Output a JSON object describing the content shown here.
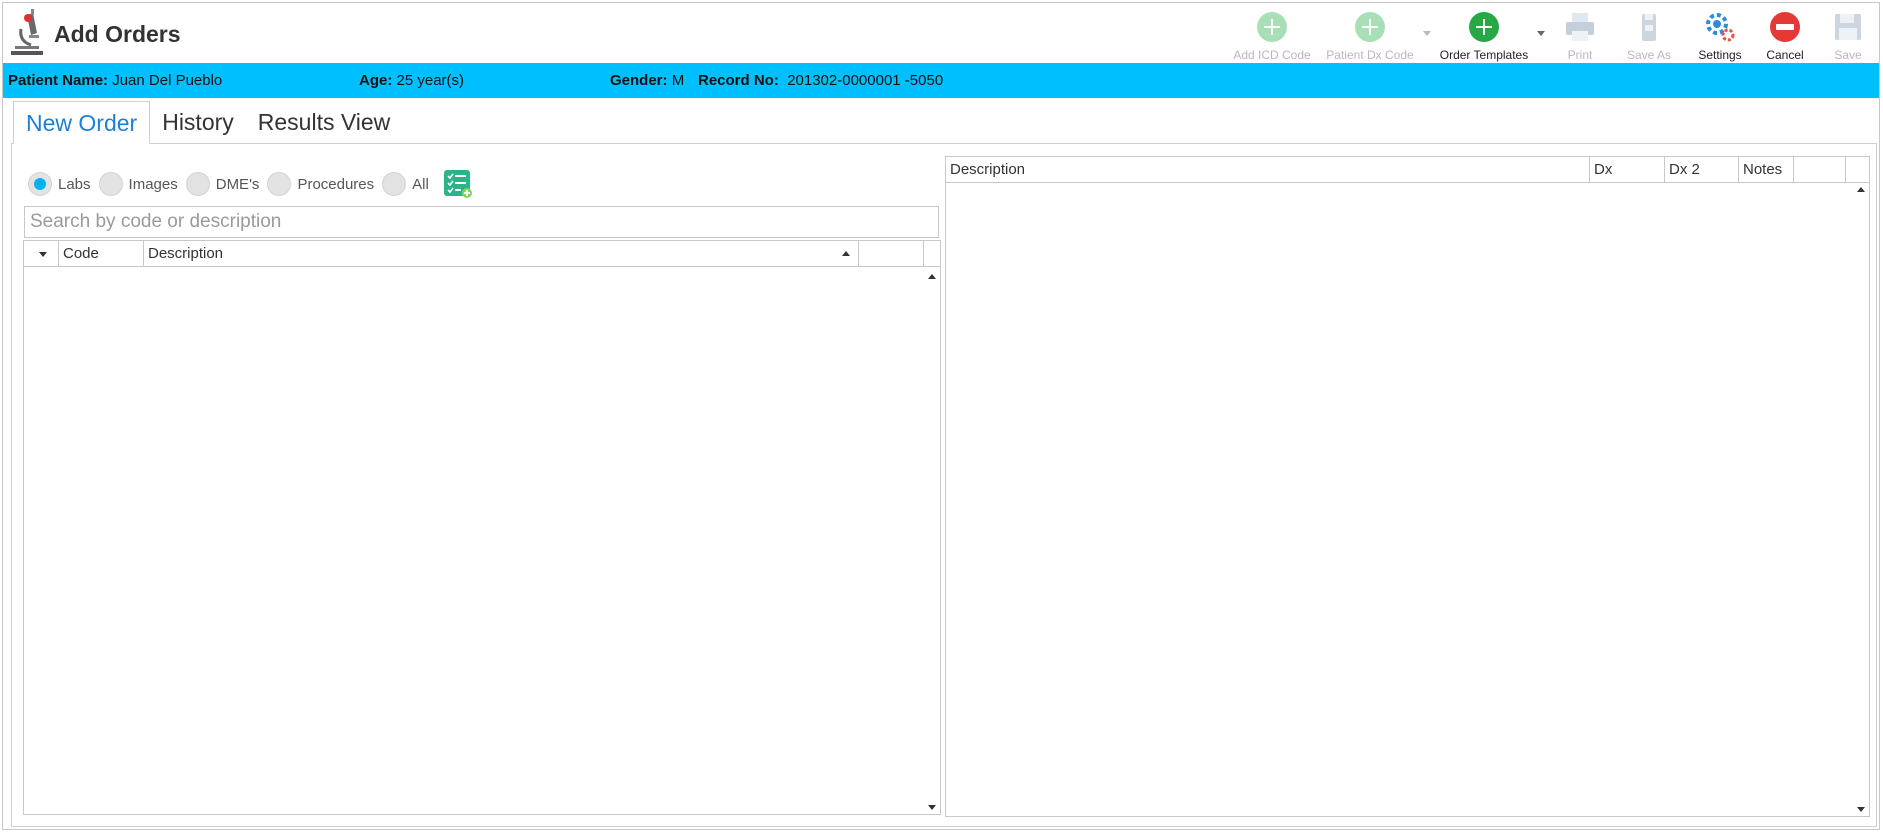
{
  "app": {
    "title": "Add Orders",
    "icon": "microscope-icon"
  },
  "toolbar": {
    "add_icd": {
      "label": "Add ICD Code",
      "icon": "plus-circle-icon",
      "enabled": false
    },
    "patient_dx": {
      "label": "Patient Dx Code",
      "icon": "plus-circle-icon",
      "enabled": false
    },
    "order_templates": {
      "label": "Order Templates",
      "icon": "plus-circle-icon",
      "enabled": true
    },
    "print": {
      "label": "Print",
      "icon": "printer-icon",
      "enabled": false
    },
    "save_as": {
      "label": "Save As",
      "icon": "save-as-icon",
      "enabled": false
    },
    "settings": {
      "label": "Settings",
      "icon": "gears-icon",
      "enabled": true
    },
    "cancel": {
      "label": "Cancel",
      "icon": "no-entry-icon",
      "enabled": true
    },
    "save": {
      "label": "Save",
      "icon": "floppy-disk-icon",
      "enabled": false
    }
  },
  "patient": {
    "name_label": "Patient Name:",
    "name": "Juan Del Pueblo",
    "age_label": "Age:",
    "age": "25 year(s)",
    "gender_label": "Gender:",
    "gender": "M",
    "record_label": "Record No:",
    "record": "201302-0000001 -5050"
  },
  "tabs": [
    {
      "label": "New Order",
      "active": true
    },
    {
      "label": "History",
      "active": false
    },
    {
      "label": "Results View",
      "active": false
    }
  ],
  "filters": [
    {
      "label": "Labs",
      "checked": true
    },
    {
      "label": "Images",
      "checked": false
    },
    {
      "label": "DME's",
      "checked": false
    },
    {
      "label": "Procedures",
      "checked": false
    },
    {
      "label": "All",
      "checked": false
    }
  ],
  "search": {
    "placeholder": "Search by code or description",
    "value": ""
  },
  "left_grid": {
    "columns": [
      "Code",
      "Description"
    ],
    "rows": []
  },
  "right_grid": {
    "columns": [
      "Description",
      "Dx",
      "Dx 2",
      "Notes"
    ],
    "rows": []
  },
  "colors": {
    "patient_bar": "#00bfff",
    "accent_tab": "#1e7fd8",
    "radio_checked": "#00b2f0",
    "order_templates_green": "#28a745",
    "cancel_red": "#e53935"
  }
}
